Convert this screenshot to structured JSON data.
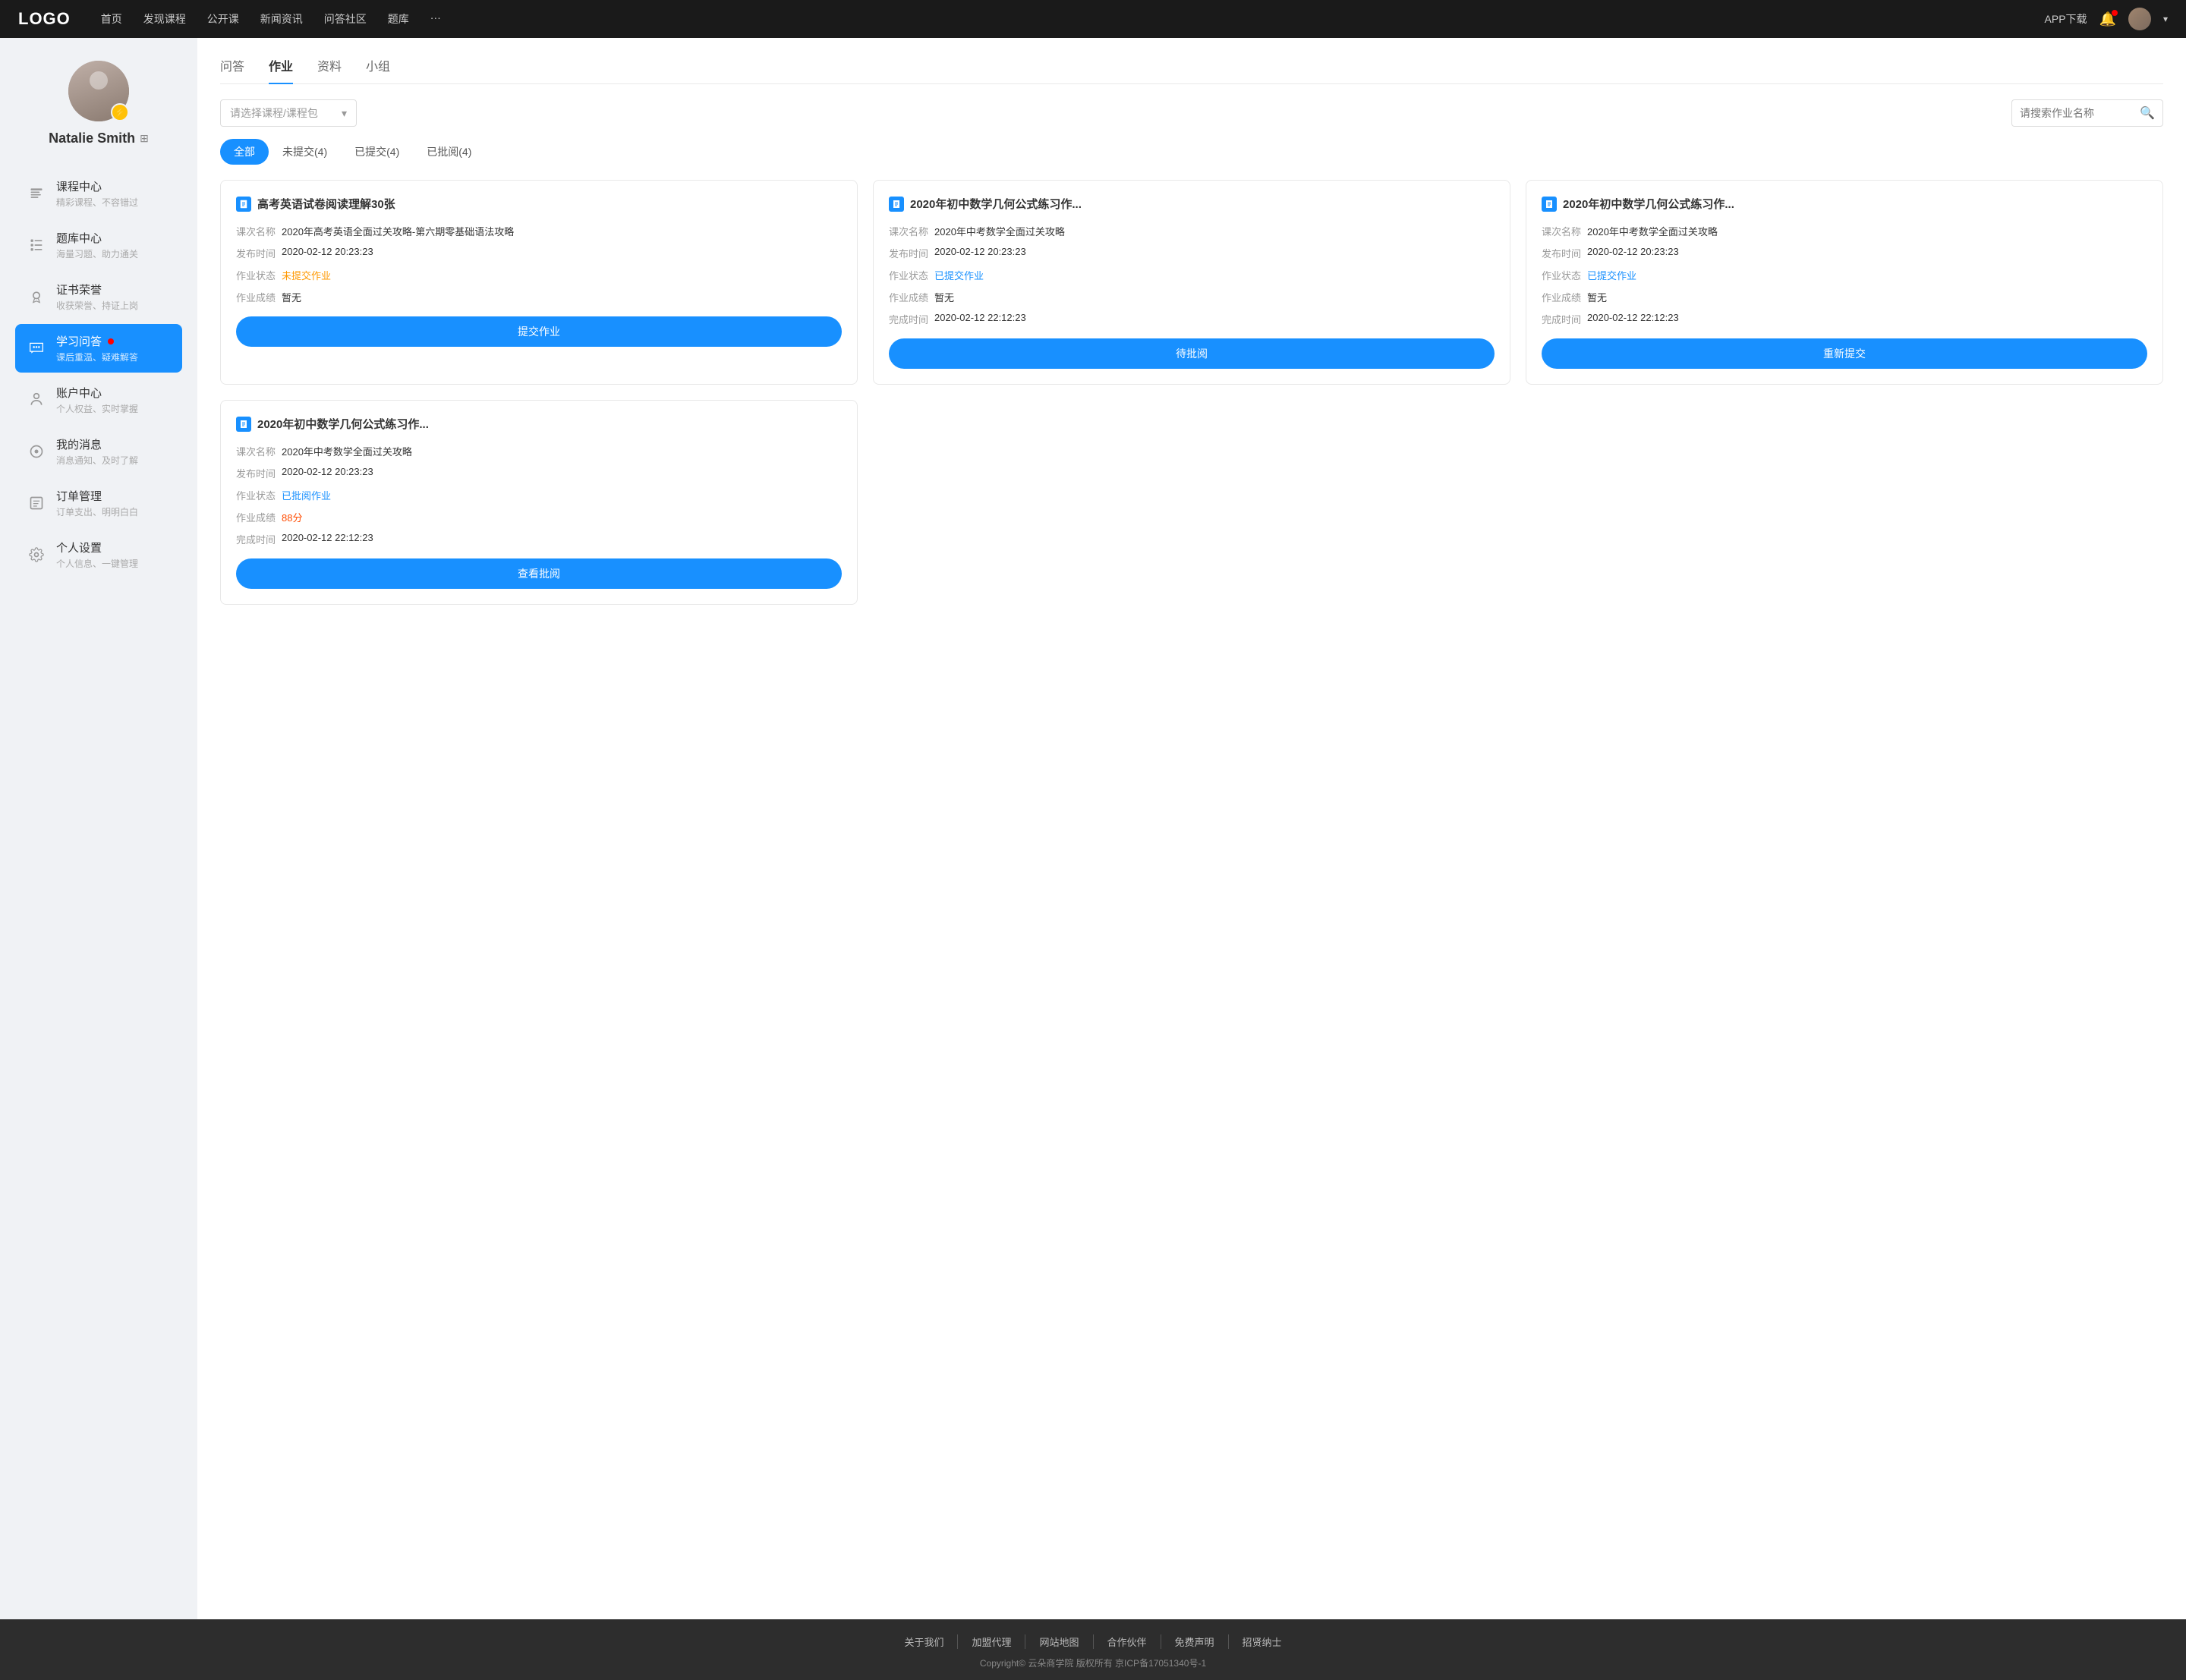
{
  "navbar": {
    "logo": "LOGO",
    "nav_items": [
      {
        "label": "首页"
      },
      {
        "label": "发现课程"
      },
      {
        "label": "公开课"
      },
      {
        "label": "新闻资讯"
      },
      {
        "label": "问答社区"
      },
      {
        "label": "题库"
      },
      {
        "label": "···"
      }
    ],
    "download": "APP下载",
    "chevron": "▾"
  },
  "sidebar": {
    "user_name": "Natalie Smith",
    "badge_icon": "★",
    "qr_label": "二维码",
    "menu_items": [
      {
        "id": "course",
        "icon": "≡",
        "title": "课程中心",
        "sub": "精彩课程、不容错过",
        "active": false
      },
      {
        "id": "question-bank",
        "icon": "☰",
        "title": "题库中心",
        "sub": "海量习题、助力通关",
        "active": false
      },
      {
        "id": "certificate",
        "icon": "⚙",
        "title": "证书荣誉",
        "sub": "收获荣誉、持证上岗",
        "active": false
      },
      {
        "id": "qa",
        "icon": "💬",
        "title": "学习问答",
        "sub": "课后重温、疑难解答",
        "active": true,
        "dot": true
      },
      {
        "id": "account",
        "icon": "◆",
        "title": "账户中心",
        "sub": "个人权益、实时掌握",
        "active": false
      },
      {
        "id": "message",
        "icon": "○",
        "title": "我的消息",
        "sub": "消息通知、及时了解",
        "active": false
      },
      {
        "id": "order",
        "icon": "≡",
        "title": "订单管理",
        "sub": "订单支出、明明白白",
        "active": false
      },
      {
        "id": "settings",
        "icon": "⚙",
        "title": "个人设置",
        "sub": "个人信息、一键管理",
        "active": false
      }
    ]
  },
  "content": {
    "tabs": [
      {
        "label": "问答",
        "active": false
      },
      {
        "label": "作业",
        "active": true
      },
      {
        "label": "资料",
        "active": false
      },
      {
        "label": "小组",
        "active": false
      }
    ],
    "course_select_placeholder": "请选择课程/课程包",
    "search_placeholder": "请搜索作业名称",
    "status_tabs": [
      {
        "label": "全部",
        "active": true
      },
      {
        "label": "未提交(4)",
        "active": false
      },
      {
        "label": "已提交(4)",
        "active": false
      },
      {
        "label": "已批阅(4)",
        "active": false
      }
    ],
    "assignments": [
      {
        "id": "a1",
        "title": "高考英语试卷阅读理解30张",
        "course": "2020年高考英语全面过关攻略-第六期零基础语法攻略",
        "publish_time": "2020-02-12 20:23:23",
        "status": "未提交作业",
        "status_type": "pending",
        "score": "暂无",
        "complete_time": null,
        "btn_label": "提交作业"
      },
      {
        "id": "a2",
        "title": "2020年初中数学几何公式练习作...",
        "course": "2020年中考数学全面过关攻略",
        "publish_time": "2020-02-12 20:23:23",
        "status": "已提交作业",
        "status_type": "submitted",
        "score": "暂无",
        "complete_time": "2020-02-12 22:12:23",
        "btn_label": "待批阅"
      },
      {
        "id": "a3",
        "title": "2020年初中数学几何公式练习作...",
        "course": "2020年中考数学全面过关攻略",
        "publish_time": "2020-02-12 20:23:23",
        "status": "已提交作业",
        "status_type": "submitted",
        "score": "暂无",
        "complete_time": "2020-02-12 22:12:23",
        "btn_label": "重新提交"
      },
      {
        "id": "a4",
        "title": "2020年初中数学几何公式练习作...",
        "course": "2020年中考数学全面过关攻略",
        "publish_time": "2020-02-12 20:23:23",
        "status": "已批阅作业",
        "status_type": "reviewed",
        "score": "88分",
        "score_type": "score",
        "complete_time": "2020-02-12 22:12:23",
        "btn_label": "查看批阅"
      }
    ],
    "assignment_fields": {
      "course_name": "课次名称",
      "publish_time": "发布时间",
      "status": "作业状态",
      "score": "作业成绩",
      "complete_time": "完成时间"
    }
  },
  "footer": {
    "links": [
      {
        "label": "关于我们"
      },
      {
        "label": "加盟代理"
      },
      {
        "label": "网站地图"
      },
      {
        "label": "合作伙伴"
      },
      {
        "label": "免费声明"
      },
      {
        "label": "招贤纳士"
      }
    ],
    "copyright": "Copyright© 云朵商学院  版权所有    京ICP备17051340号-1"
  }
}
